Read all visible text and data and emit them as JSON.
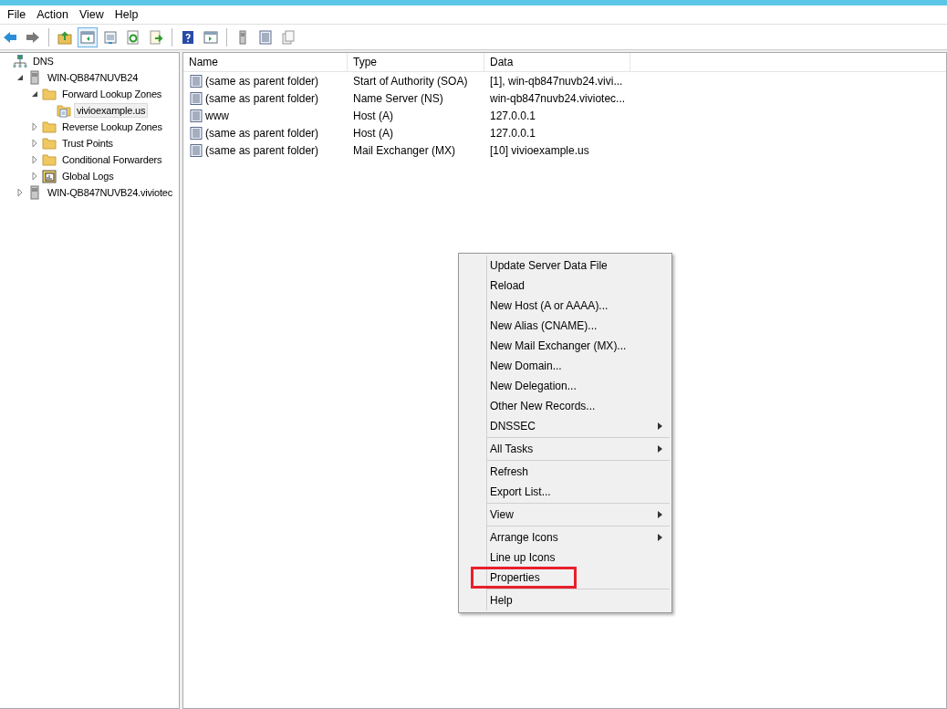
{
  "menu_bar": [
    "File",
    "Action",
    "View",
    "Help"
  ],
  "toolbar": [
    {
      "kind": "back",
      "selected": false
    },
    {
      "kind": "forward",
      "selected": false
    },
    {
      "kind": "separator"
    },
    {
      "kind": "up",
      "selected": false
    },
    {
      "kind": "tree",
      "selected": true
    },
    {
      "kind": "properties",
      "selected": false
    },
    {
      "kind": "refresh",
      "selected": false
    },
    {
      "kind": "export",
      "selected": false
    },
    {
      "kind": "separator"
    },
    {
      "kind": "help",
      "selected": false
    },
    {
      "kind": "pane",
      "selected": false
    },
    {
      "kind": "separator"
    },
    {
      "kind": "server",
      "selected": false
    },
    {
      "kind": "list",
      "selected": false
    },
    {
      "kind": "copy",
      "selected": false
    }
  ],
  "tree": [
    {
      "label": "DNS",
      "kind": "dns",
      "selected": false,
      "children": [
        {
          "label": "WIN-QB847NUVB24",
          "kind": "server",
          "expanded": true,
          "selected": false,
          "children": [
            {
              "label": "Forward Lookup Zones",
              "kind": "folder",
              "expanded": true,
              "selected": false,
              "children": [
                {
                  "label": "vivioexample.us",
                  "kind": "zone",
                  "selected": true
                }
              ]
            },
            {
              "label": "Reverse Lookup Zones",
              "kind": "folder",
              "expanded": false,
              "selected": false
            },
            {
              "label": "Trust Points",
              "kind": "folder",
              "expanded": false,
              "selected": false
            },
            {
              "label": "Conditional Forwarders",
              "kind": "folder",
              "expanded": false,
              "selected": false
            },
            {
              "label": "Global Logs",
              "kind": "log",
              "expanded": false,
              "selected": false
            }
          ]
        },
        {
          "label": "WIN-QB847NUVB24.viviotec",
          "kind": "server",
          "expanded": false,
          "selected": false
        }
      ]
    }
  ],
  "table": {
    "columns": [
      "Name",
      "Type",
      "Data"
    ],
    "rows": [
      [
        "(same as parent folder)",
        "Start of Authority (SOA)",
        "[1], win-qb847nuvb24.vivi..."
      ],
      [
        "(same as parent folder)",
        "Name Server (NS)",
        "win-qb847nuvb24.viviotec..."
      ],
      [
        "www",
        "Host (A)",
        "127.0.0.1"
      ],
      [
        "(same as parent folder)",
        "Host (A)",
        "127.0.0.1"
      ],
      [
        "(same as parent folder)",
        "Mail Exchanger (MX)",
        "[10]  vivioexample.us"
      ]
    ]
  },
  "context_menu": [
    {
      "kind": "item",
      "label": "Update Server Data File",
      "submenu": false,
      "highlighted": false
    },
    {
      "kind": "item",
      "label": "Reload",
      "submenu": false,
      "highlighted": false
    },
    {
      "kind": "item",
      "label": "New Host (A or AAAA)...",
      "submenu": false,
      "highlighted": false
    },
    {
      "kind": "item",
      "label": "New Alias (CNAME)...",
      "submenu": false,
      "highlighted": false
    },
    {
      "kind": "item",
      "label": "New Mail Exchanger (MX)...",
      "submenu": false,
      "highlighted": false
    },
    {
      "kind": "item",
      "label": "New Domain...",
      "submenu": false,
      "highlighted": false
    },
    {
      "kind": "item",
      "label": "New Delegation...",
      "submenu": false,
      "highlighted": false
    },
    {
      "kind": "item",
      "label": "Other New Records...",
      "submenu": false,
      "highlighted": false
    },
    {
      "kind": "item",
      "label": "DNSSEC",
      "submenu": true,
      "highlighted": false
    },
    {
      "kind": "separator"
    },
    {
      "kind": "item",
      "label": "All Tasks",
      "submenu": true,
      "highlighted": false
    },
    {
      "kind": "separator"
    },
    {
      "kind": "item",
      "label": "Refresh",
      "submenu": false,
      "highlighted": false
    },
    {
      "kind": "item",
      "label": "Export List...",
      "submenu": false,
      "highlighted": false
    },
    {
      "kind": "separator"
    },
    {
      "kind": "item",
      "label": "View",
      "submenu": true,
      "highlighted": false
    },
    {
      "kind": "separator"
    },
    {
      "kind": "item",
      "label": "Arrange Icons",
      "submenu": true,
      "highlighted": false
    },
    {
      "kind": "item",
      "label": "Line up Icons",
      "submenu": false,
      "highlighted": false
    },
    {
      "kind": "item",
      "label": "Properties",
      "submenu": false,
      "highlighted": true
    },
    {
      "kind": "separator"
    },
    {
      "kind": "item",
      "label": "Help",
      "submenu": false,
      "highlighted": false
    }
  ]
}
